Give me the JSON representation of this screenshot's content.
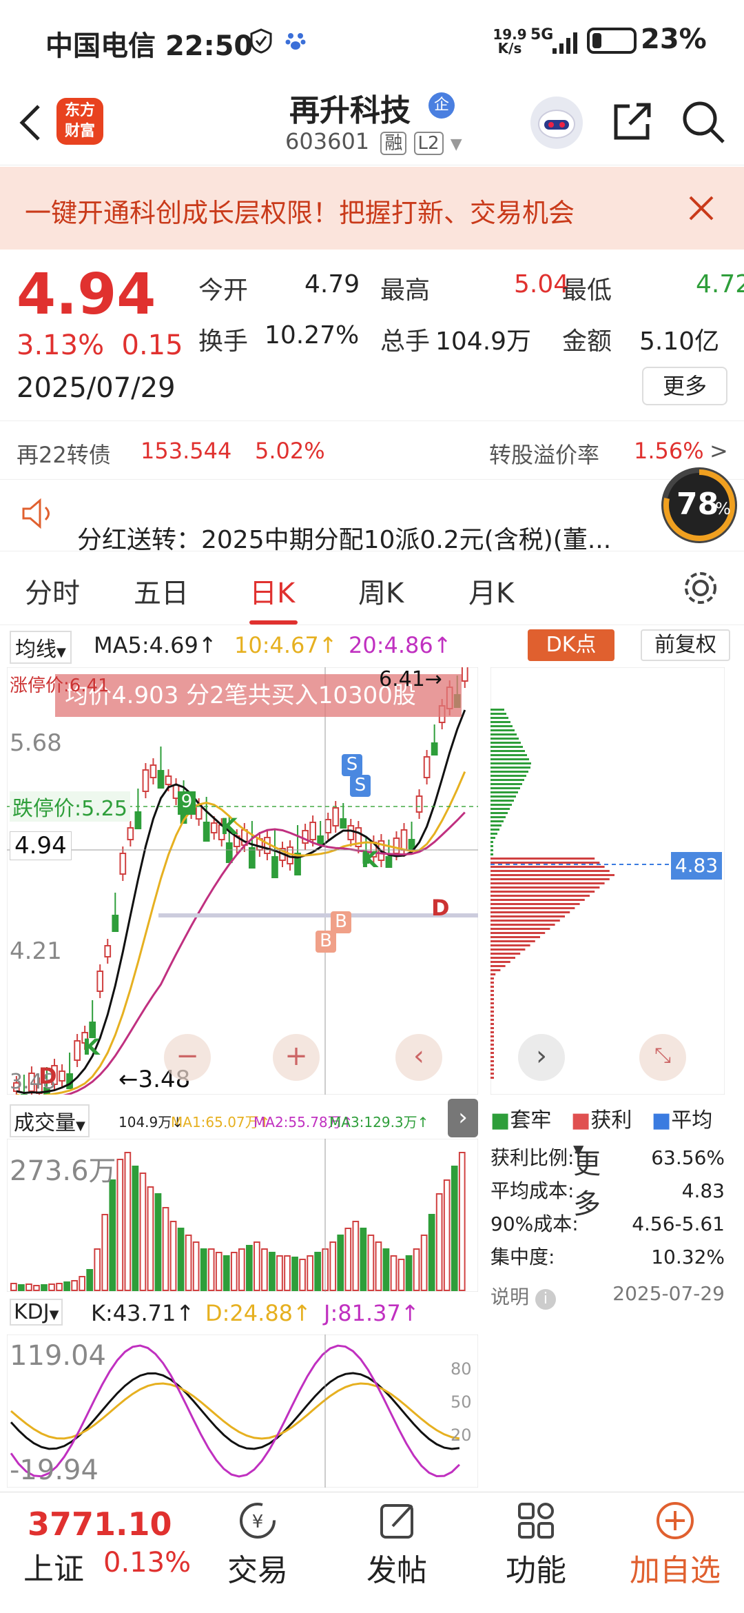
{
  "status_bar": {
    "carrier": "中国电信",
    "time": "22:50",
    "net_speed_top": "19.9",
    "net_speed_bottom": "K/s",
    "signal": "5G",
    "battery": "23%",
    "battery_level": 0.23
  },
  "header": {
    "stock_name": "再升科技",
    "badge": "企",
    "code": "603601",
    "tag1": "融",
    "tag2": "L2",
    "logo_text_1": "东方",
    "logo_text_2": "财富"
  },
  "banner": {
    "text": "一键开通科创成长层权限！把握打新、交易机会"
  },
  "quote": {
    "price": "4.94",
    "change_pct": "3.13%",
    "change": "0.15",
    "date": "2025/07/29",
    "open_label": "今开",
    "open": "4.79",
    "high_label": "最高",
    "high": "5.04",
    "low_label": "最低",
    "low": "4.72",
    "turnover_label": "换手",
    "turnover": "10.27%",
    "volume_label": "总手",
    "volume": "104.9万",
    "amount_label": "金额",
    "amount": "5.10亿",
    "more_button": "更多"
  },
  "bond": {
    "name": "再22转债",
    "price": "153.544",
    "change": "5.02%",
    "premium_label": "转股溢价率",
    "premium": "1.56%",
    "arrow": ">"
  },
  "notice": {
    "text": "分红送转：2025中期分配10派0.2元(含税)(董...",
    "gauge": "78",
    "gauge_unit": "%"
  },
  "tabs": [
    "分时",
    "五日",
    "日K",
    "周K",
    "月K",
    "更多"
  ],
  "active_tab": "日K",
  "ma_bar": {
    "selector": "均线",
    "ma5": "MA5:4.69",
    "ma10": "10:4.67",
    "ma20": "20:4.86",
    "dk_button": "DK点",
    "adjust_button": "前复权"
  },
  "kchart": {
    "limit_up_label": "涨停价:6.41",
    "limit_down_label": "跌停价:5.25",
    "y_labels": [
      "6.41",
      "5.68",
      "4.94",
      "4.21",
      "3.48"
    ],
    "current_price_tag": "4.94",
    "max_tag": "6.41",
    "min_tag": "3.48",
    "popup": "均价4.903  分2笔共买入10300股",
    "markers": [
      "K",
      "K",
      "K",
      "9",
      "S",
      "S",
      "B",
      "B",
      "D",
      "D"
    ],
    "chip_price": "4.83"
  },
  "chips": {
    "legend": [
      "套牢",
      "获利",
      "平均"
    ],
    "legend_colors": [
      "#2e9e3a",
      "#e05050",
      "#3a7be0"
    ],
    "rows": [
      {
        "label": "获利比例:",
        "value": "63.56%"
      },
      {
        "label": "平均成本:",
        "value": "4.83"
      },
      {
        "label": "90%成本:",
        "value": "4.56-5.61"
      },
      {
        "label": "集中度:",
        "value": "10.32%"
      }
    ],
    "explain": "说明",
    "date": "2025-07-29"
  },
  "volume": {
    "selector": "成交量",
    "v": "104.9万",
    "ma1": "MA1:65.07万",
    "ma2": "MA2:55.78万",
    "ma3": "MA3:129.3万",
    "top_label": "273.6万"
  },
  "kdj": {
    "selector": "KDJ",
    "k": "K:43.71",
    "d": "D:24.88",
    "j": "J:81.37",
    "top": "119.04",
    "bottom": "-19.94",
    "levels": [
      "80",
      "50",
      "20"
    ]
  },
  "bottom_nav": {
    "index_value": "3771.10",
    "index_name": "上证",
    "index_change": "0.13%",
    "items": [
      "交易",
      "发帖",
      "功能",
      "加自选"
    ]
  }
}
